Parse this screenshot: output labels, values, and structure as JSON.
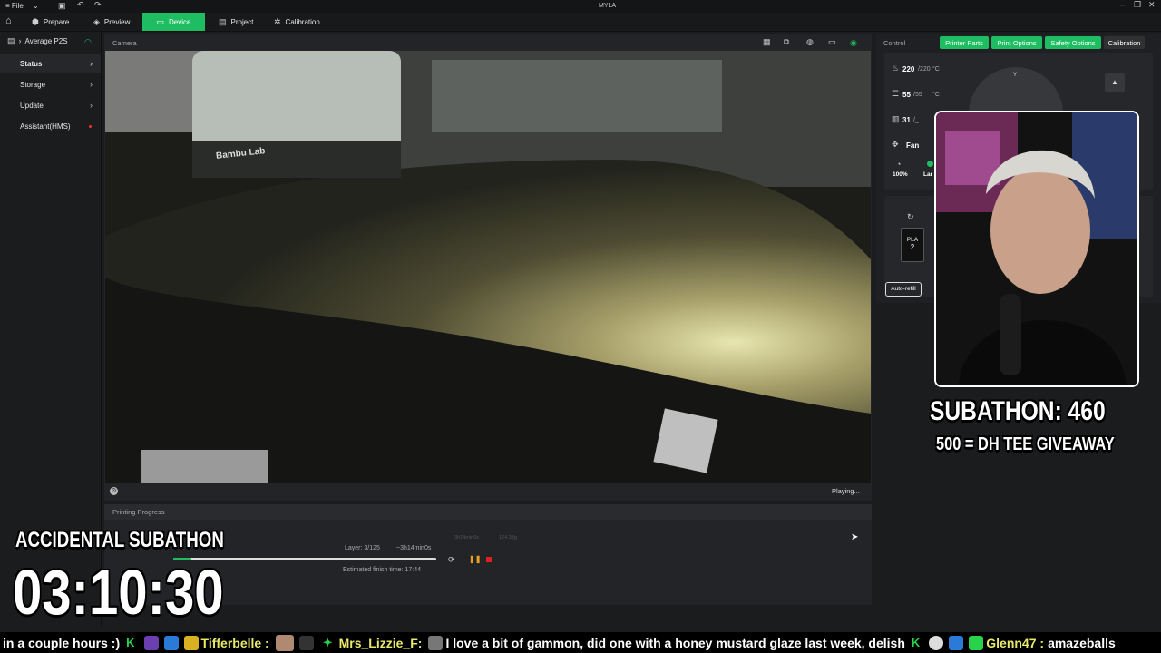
{
  "app": {
    "title": "MYLA",
    "file_menu": "File"
  },
  "nav": {
    "tabs": [
      {
        "label": "Prepare"
      },
      {
        "label": "Preview"
      },
      {
        "label": "Device"
      },
      {
        "label": "Project"
      },
      {
        "label": "Calibration"
      }
    ],
    "active_tab": "Device",
    "accent_color": "#1fbd62"
  },
  "sidebar": {
    "printer_name": "Average P2S",
    "items": [
      {
        "label": "Status"
      },
      {
        "label": "Storage"
      },
      {
        "label": "Update"
      },
      {
        "label": "Assistant(HMS)"
      }
    ]
  },
  "camera": {
    "title": "Camera",
    "status": "Playing...",
    "printer_brand_text": "Bambu Lab"
  },
  "progress": {
    "title": "Printing Progress",
    "layer": "Layer: 3/125",
    "remaining": "~3h14min0s",
    "finish_time": "Estimated finish time: 17:44",
    "faint_time": "3h14min0s",
    "faint_weight": "124.33g",
    "fraction": 0.07
  },
  "control": {
    "title": "Control",
    "buttons": [
      {
        "label": "Printer Parts"
      },
      {
        "label": "Print Options"
      },
      {
        "label": "Safety Options"
      },
      {
        "label": "Calibration"
      }
    ],
    "nozzle": {
      "current": "220",
      "target": "/220",
      "unit": "°C"
    },
    "bed": {
      "current": "55",
      "target": "/55",
      "unit": "°C"
    },
    "chamber": {
      "current": "31",
      "target": "/_"
    },
    "fan_label": "Fan",
    "fan_speed": "100%",
    "fan_name": "Lar",
    "filament": "PLA",
    "filament_slot": "2",
    "auto_refill": "Auto-refill",
    "jog_axis_label": "Y"
  },
  "overlay": {
    "subathon_count": "SUBATHON: 460",
    "goal": "500 = DH TEE GIVEAWAY",
    "accidental": "ACCIDENTAL SUBATHON",
    "timer": "03:10:30"
  },
  "ticker": {
    "lead": "in a couple hours :)",
    "user1": "Tifferbelle :",
    "user2": "Mrs_Lizzie_F:",
    "message2": "I love a bit of gammon, did one with a honey mustard glaze last week, delish",
    "user3": "Glenn47 :",
    "message3": "amazeballs"
  }
}
